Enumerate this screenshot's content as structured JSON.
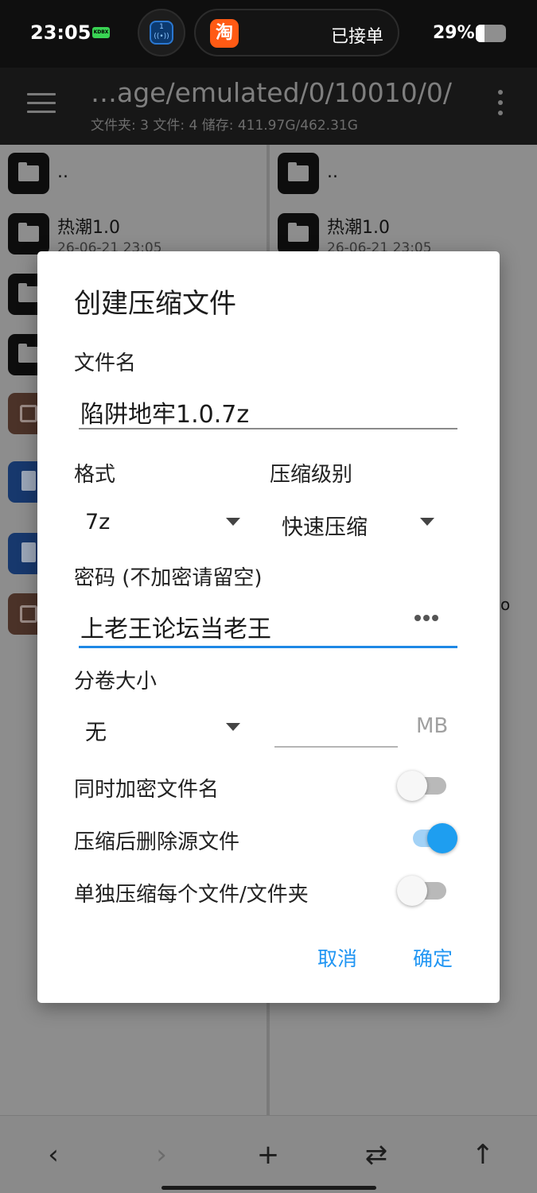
{
  "status_bar": {
    "time": "23:05",
    "kdbx_badge": "KDBX",
    "radio_number": "1",
    "taobao_glyph": "淘",
    "order_status": "已接单",
    "battery_text": "29%",
    "battery_level": 0.29
  },
  "toolbar": {
    "path": "…age/emulated/0/10010/0/",
    "stats": "文件夹: 3  文件: 4  储存: 411.97G/462.31G"
  },
  "left_pane": {
    "parent": "..",
    "items": [
      {
        "name": "热潮1.0",
        "date": "26-06-21 23:05"
      }
    ]
  },
  "right_pane": {
    "parent": "..",
    "items": [
      {
        "name": "热潮1.0",
        "date": "26-06-21 23:05"
      }
    ],
    "fragment": "o"
  },
  "dialog": {
    "title": "创建压缩文件",
    "filename_label": "文件名",
    "filename_value": "陷阱地牢1.0.7z",
    "format_label": "格式",
    "format_value": "7z",
    "level_label": "压缩级别",
    "level_value": "快速压缩",
    "password_label": "密码 (不加密请留空)",
    "password_value": "上老王论坛当老王",
    "split_label": "分卷大小",
    "split_value": "无",
    "split_unit": "MB",
    "encrypt_names_label": "同时加密文件名",
    "encrypt_names_on": false,
    "delete_source_label": "压缩后删除源文件",
    "delete_source_on": true,
    "separate_label": "单独压缩每个文件/文件夹",
    "separate_on": false,
    "cancel": "取消",
    "confirm": "确定"
  },
  "bottom_nav": {
    "back": "‹",
    "forward": "›",
    "add": "+",
    "swap": "⇄",
    "up": "↑"
  }
}
